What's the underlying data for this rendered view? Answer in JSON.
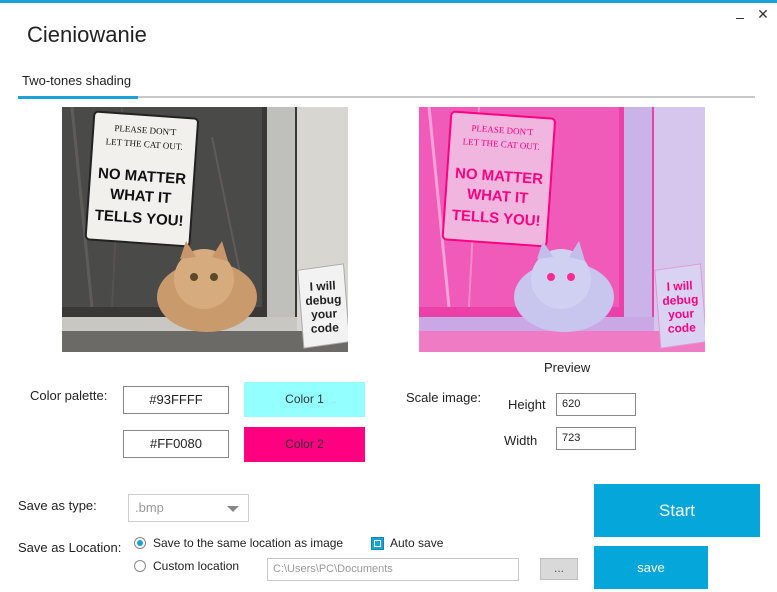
{
  "window": {
    "title": "Cieniowanie",
    "minimize_label": "",
    "close_label": "✕"
  },
  "tabs": [
    {
      "label": "Two-tones shading",
      "active": true
    }
  ],
  "images": {
    "original": {
      "sign_lines": [
        "PLEASE DON'T",
        "LET THE CAT OUT.",
        "NO MATTER",
        "WHAT IT",
        "TELLS YOU!"
      ],
      "note_lines": [
        "I will",
        "debug",
        "your",
        "code"
      ]
    },
    "preview": {
      "caption": "Preview",
      "sign_lines": [
        "PLEASE DON'T",
        "LET THE CAT OUT.",
        "NO MATTER",
        "WHAT IT",
        "TELLS YOU!"
      ],
      "note_lines": [
        "I will",
        "debug",
        "your",
        "code"
      ]
    }
  },
  "palette": {
    "label": "Color palette:",
    "color1": {
      "hex": "#93FFFF",
      "button_label": "Color 1"
    },
    "color2": {
      "hex": "#FF0080",
      "button_label": "Color 2"
    }
  },
  "scale": {
    "label": "Scale image:",
    "height_label": "Height",
    "height_value": "620",
    "width_label": "Width",
    "width_value": "723"
  },
  "save": {
    "type_label": "Save as type:",
    "type_value": ".bmp",
    "location_label": "Save as Location:",
    "option_same": "Save to the same location as image",
    "option_custom": "Custom location",
    "auto_save_label": "Auto save",
    "path_value": "C:\\Users\\PC\\Documents",
    "browse_label": "...",
    "start_label": "Start",
    "save_label": "save"
  },
  "colors": {
    "accent": "#05a6d9",
    "color1": "#93ffff",
    "color2": "#ff0080"
  }
}
